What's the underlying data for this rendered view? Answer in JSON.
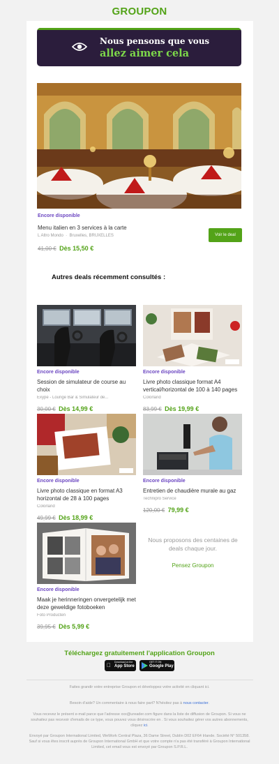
{
  "brand": {
    "logo": "GROUPON",
    "accent": "#53a318",
    "purple": "#6b46c1",
    "banner_bg": "#2b1d3c"
  },
  "banner": {
    "icon": "eye-icon",
    "line1": "Nous pensons que vous",
    "line2": "allez aimer cela"
  },
  "hero": {
    "status": "Encore disponible",
    "title": "Menu italien en 3 services à la carte",
    "merchant": "L Altro Mondo",
    "separator": "·",
    "location": "Bruxelles, BRUXELLES",
    "old_price": "41,00 €",
    "new_price": "Dès 15,50 €",
    "button": "Voir le deal"
  },
  "section_title": "Autres deals récemment consultés :",
  "deals": [
    {
      "status": "Encore disponible",
      "title": "Session de simulateur de course au choix",
      "merchant": "Exype - Lounge Bar & Simulateur de...",
      "old_price": "30,00 €",
      "new_price": "Dès 14,99 €"
    },
    {
      "status": "Encore disponible",
      "title": "Livre photo classique format A4 vertical/horizontal de 100 à 140 pages",
      "merchant": "Colorland",
      "old_price": "83,99 €",
      "new_price": "Dès 19,99 €"
    },
    {
      "status": "Encore disponible",
      "title": "Livre photo classique en format A3 horizontal de 28 à 100 pages",
      "merchant": "Colorland",
      "old_price": "49,99 €",
      "new_price": "Dès 18,99 €"
    },
    {
      "status": "Encore disponible",
      "title": "Entretien de chaudière murale au gaz",
      "merchant": "Technipro Service",
      "old_price": "120,00 €",
      "new_price": "79,99 €"
    },
    {
      "status": "Encore disponible",
      "title": "Maak je herinneringen onvergetelijk met deze geweldige fotoboeken",
      "merchant": "Foto Producten",
      "old_price": "39,95 €",
      "new_price": "Dès 5,99 €"
    }
  ],
  "promo": {
    "text": "Nous proposons des centaines de deals chaque jour.",
    "link": "Pensez Groupon"
  },
  "app": {
    "title": "Téléchargez gratuitement l'application Groupon",
    "appstore_small": "Download on the",
    "appstore_big": "App Store",
    "play_small": "GET IT ON",
    "play_big": "Google Play"
  },
  "footer": {
    "business": "Faites grandir votre entreprise Groupon et développez votre activité en cliquant ici.",
    "help": "Besoin d'aide? Un commentaire à nous faire part? N'hésitez pas à",
    "help_link": "nous contacter",
    "help_end": ".",
    "notice": "Vous recevez le présent e-mail parce que l'adresse xxx@ureader.com figure dans la liste de diffusion de Groupon. Si vous ne souhaitez pas recevoir d'emails de ce type, vous pouvez vous désinscrire en . Si vous souhaitez gérer vos autres abonnements, cliquez",
    "notice_link": "ici",
    "notice_end": ".",
    "legal": "Envoyé par Groupon International Limited, WeWork Central Plaza, 36 Dame Street, Dublin D02 EF64 Irlande. Société N° 501358. Sauf si vous êtes inscrit auprès de Groupon International GmbH et que votre compte n'a pas été transféré à Groupon International Limited, cet email vous est envoyé par Groupon S.P.R.L."
  }
}
